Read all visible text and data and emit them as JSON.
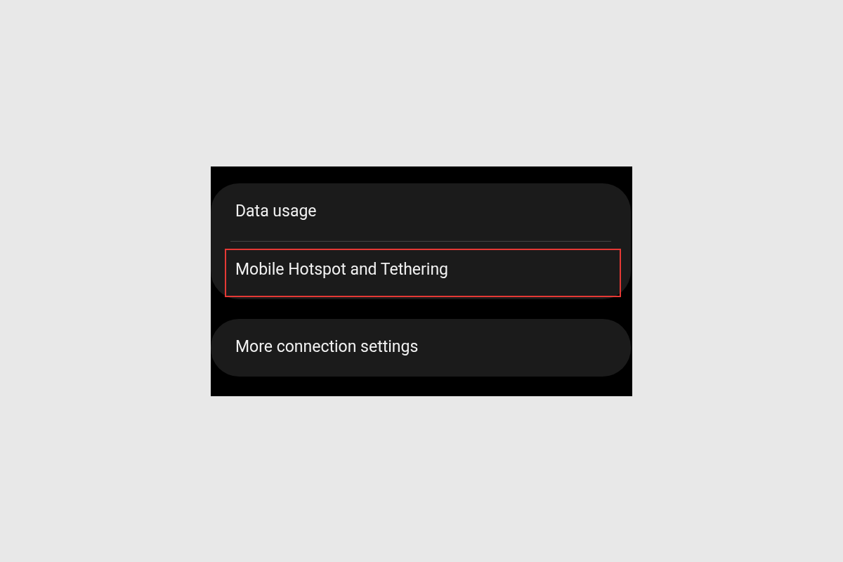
{
  "groups": [
    {
      "items": [
        {
          "label": "Data usage",
          "highlighted": false
        },
        {
          "label": "Mobile Hotspot and Tethering",
          "highlighted": true
        }
      ]
    },
    {
      "items": [
        {
          "label": "More connection settings",
          "highlighted": false
        }
      ]
    }
  ]
}
